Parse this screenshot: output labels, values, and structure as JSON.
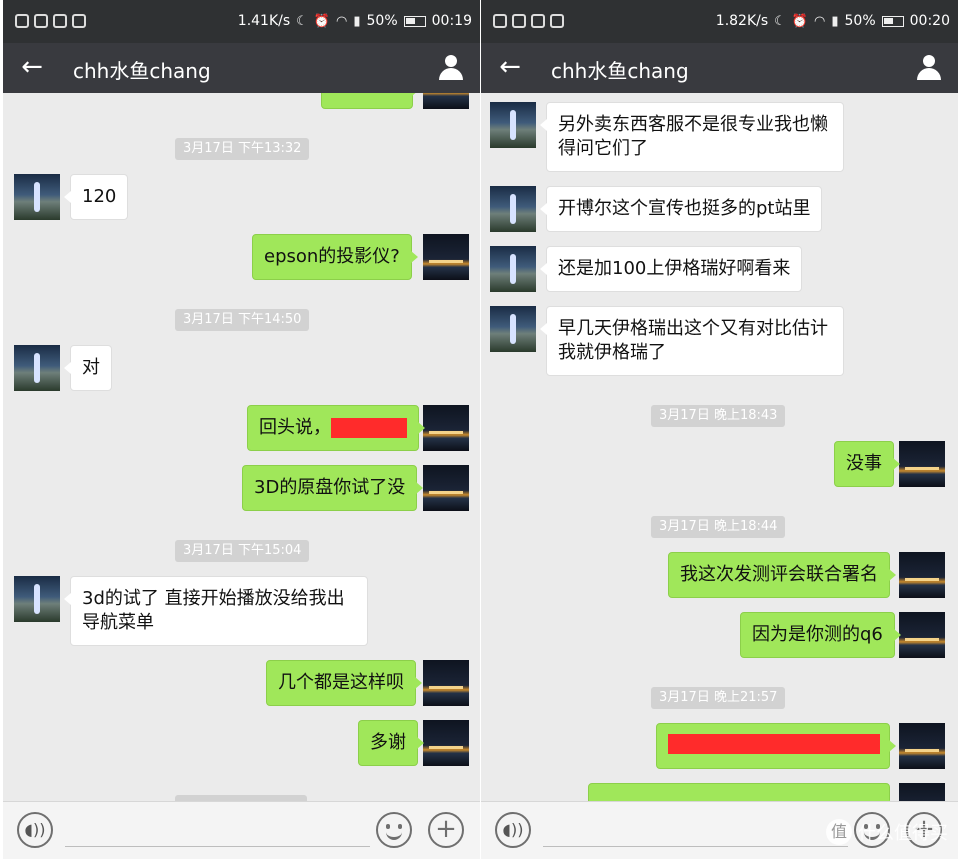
{
  "left": {
    "status": {
      "speed": "1.41K/s",
      "battery": "50%",
      "time": "00:19"
    },
    "title": "chh水鱼chang",
    "messages": [
      {
        "kind": "ts",
        "text": "3月17日 下午13:32"
      },
      {
        "kind": "other",
        "text": "120"
      },
      {
        "kind": "me",
        "text": "epson的投影仪?"
      },
      {
        "kind": "ts",
        "text": "3月17日 下午14:50"
      },
      {
        "kind": "other",
        "text": "对"
      },
      {
        "kind": "me",
        "text": "回头说，"
      },
      {
        "kind": "me",
        "text": "3D的原盘你试了没"
      },
      {
        "kind": "ts",
        "text": "3月17日 下午15:04"
      },
      {
        "kind": "other",
        "text": "3d的试了 直接开始播放没给我出导航菜单"
      },
      {
        "kind": "me",
        "text": "几个都是这样呗"
      },
      {
        "kind": "me",
        "text": "多谢"
      }
    ]
  },
  "right": {
    "status": {
      "speed": "1.82K/s",
      "battery": "50%",
      "time": "00:20"
    },
    "title": "chh水鱼chang",
    "messages": [
      {
        "kind": "other",
        "text": "另外卖东西客服不是很专业我也懒得问它们了"
      },
      {
        "kind": "other",
        "text": "开博尔这个宣传也挺多的pt站里"
      },
      {
        "kind": "other",
        "text": "还是加100上伊格瑞好啊看来"
      },
      {
        "kind": "other",
        "text": "早几天伊格瑞出这个又有对比估计我就伊格瑞了"
      },
      {
        "kind": "ts",
        "text": "3月17日 晚上18:43"
      },
      {
        "kind": "me",
        "text": "没事"
      },
      {
        "kind": "ts",
        "text": "3月17日 晚上18:44"
      },
      {
        "kind": "me",
        "text": "我这次发测评会联合署名"
      },
      {
        "kind": "me",
        "text": "因为是你测的q6"
      },
      {
        "kind": "ts",
        "text": "3月17日 晚上21:57"
      }
    ],
    "watermark": "什么值得买"
  },
  "icons": {
    "back": "back-arrow-icon",
    "contact": "person-icon",
    "voice": "voice-icon",
    "emoji": "emoji-icon",
    "more": "plus-icon"
  },
  "colors": {
    "my_bubble": "#a0e75a",
    "other_bubble": "#ffffff",
    "title_bar": "#393a3f",
    "chat_bg": "#ebebeb",
    "redaction": "#ff2b2b"
  }
}
